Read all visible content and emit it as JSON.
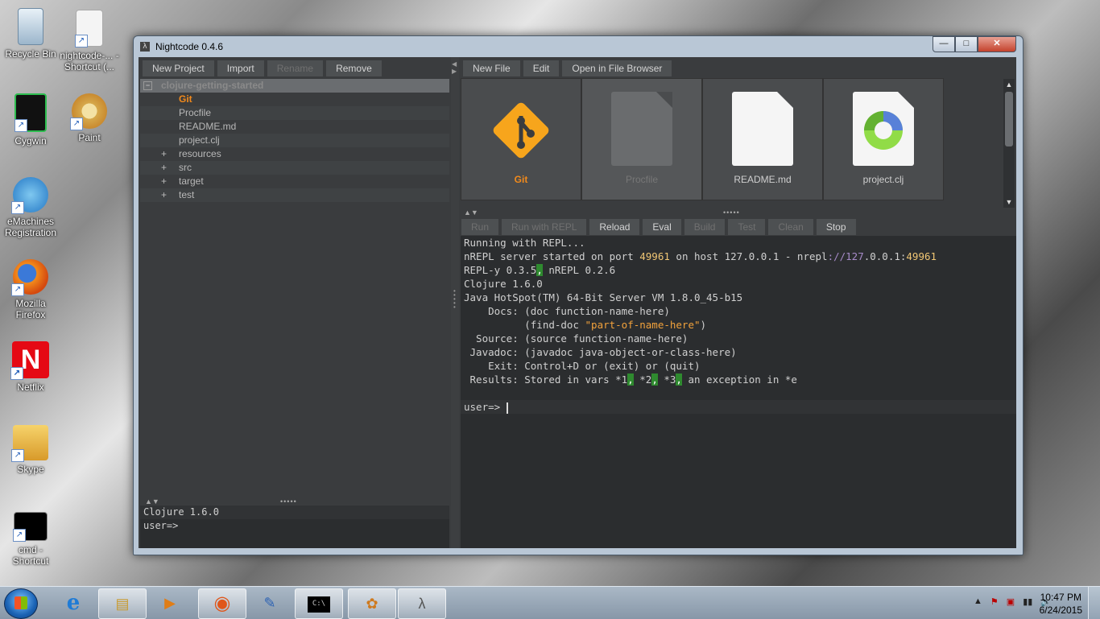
{
  "desktop_icons": [
    {
      "label": "Recycle Bin",
      "icon": "recycle-bin-icon"
    },
    {
      "label": "nightcode-... - Shortcut (...",
      "icon": "java-file-icon"
    },
    {
      "label": "Cygwin",
      "icon": "cygwin-icon"
    },
    {
      "label": "Paint",
      "icon": "paint-icon"
    },
    {
      "label": "eMachines Registration",
      "icon": "registration-icon"
    },
    {
      "label": "Mozilla Firefox",
      "icon": "firefox-icon"
    },
    {
      "label": "Netflix",
      "icon": "netflix-icon"
    },
    {
      "label": "Skype",
      "icon": "skype-icon"
    },
    {
      "label": "cmd - Shortcut",
      "icon": "cmd-icon"
    }
  ],
  "window": {
    "title": "Nightcode 0.4.6",
    "controls": {
      "minimize": "—",
      "maximize": "□",
      "close": "✕"
    }
  },
  "left_toolbar": [
    {
      "label": "New Project",
      "enabled": true
    },
    {
      "label": "Import",
      "enabled": true
    },
    {
      "label": "Rename",
      "enabled": false
    },
    {
      "label": "Remove",
      "enabled": true
    }
  ],
  "tree": {
    "root": "clojure-getting-started",
    "items": [
      {
        "label": "Git",
        "expandable": false,
        "highlight": true
      },
      {
        "label": "Procfile",
        "expandable": false
      },
      {
        "label": "README.md",
        "expandable": false
      },
      {
        "label": "project.clj",
        "expandable": false
      },
      {
        "label": "resources",
        "expandable": true
      },
      {
        "label": "src",
        "expandable": true
      },
      {
        "label": "target",
        "expandable": true
      },
      {
        "label": "test",
        "expandable": true
      }
    ],
    "expand_symbol": "+",
    "collapse_symbol": "−"
  },
  "left_repl": {
    "lines": [
      "Clojure 1.6.0",
      "user=>"
    ]
  },
  "right_toolbar": [
    {
      "label": "New File"
    },
    {
      "label": "Edit"
    },
    {
      "label": "Open in File Browser"
    }
  ],
  "tiles": [
    {
      "label": "Git",
      "icon": "git-icon"
    },
    {
      "label": "Procfile",
      "icon": "blank-file-icon"
    },
    {
      "label": "README.md",
      "icon": "document-icon"
    },
    {
      "label": "project.clj",
      "icon": "clojure-file-icon"
    }
  ],
  "run_toolbar": [
    {
      "label": "Run",
      "enabled": false
    },
    {
      "label": "Run with REPL",
      "enabled": false
    },
    {
      "label": "Reload",
      "enabled": true
    },
    {
      "label": "Eval",
      "enabled": true
    },
    {
      "label": "Build",
      "enabled": false
    },
    {
      "label": "Test",
      "enabled": false
    },
    {
      "label": "Clean",
      "enabled": false
    },
    {
      "label": "Stop",
      "enabled": true
    }
  ],
  "console": {
    "line1": "Running with REPL...",
    "line2_a": "nREPL server started on port ",
    "port": "49961",
    "line2_b": " on host 127.0.0.1 - nrepl",
    "url_mid": "://127",
    "url_rest": ".0.0.1:",
    "line3_a": "REPL-y 0.3.5",
    "line3_b": " nREPL 0.2.6",
    "comma": ",",
    "line4": "Clojure 1.6.0",
    "line5": "Java HotSpot(TM) 64-Bit Server VM 1.8.0_45-b15",
    "docs_a": "    Docs: (doc function-name-here)",
    "docs_b": "          (find-doc ",
    "docs_str": "\"part-of-name-here\"",
    "docs_c": ")",
    "source": "  Source: (source function-name-here)",
    "javadoc": " Javadoc: (javadoc java-object-or-class-here)",
    "exit": "    Exit: Control+D or (exit) or (quit)",
    "results_a": " Results: Stored in vars *1",
    "results_b": " *2",
    "results_c": " *3",
    "results_d": " an exception in *e",
    "prompt": "user=> "
  },
  "taskbar": {
    "items": [
      {
        "icon": "ie-icon",
        "glyph": "e"
      },
      {
        "icon": "file-explorer-icon",
        "glyph": "▤"
      },
      {
        "icon": "media-player-icon",
        "glyph": "▶"
      },
      {
        "icon": "firefox-icon",
        "glyph": "◉"
      },
      {
        "icon": "registration-icon",
        "glyph": "✎"
      },
      {
        "icon": "cmd-icon",
        "glyph": "C:\\"
      },
      {
        "icon": "paint-icon",
        "glyph": "✿"
      },
      {
        "icon": "nightcode-icon",
        "glyph": "λ"
      }
    ],
    "tray_glyphs": [
      "▲",
      "⚑",
      "▣",
      "▮▮",
      "🔈"
    ],
    "time": "10:47 PM",
    "date": "6/24/2015"
  }
}
